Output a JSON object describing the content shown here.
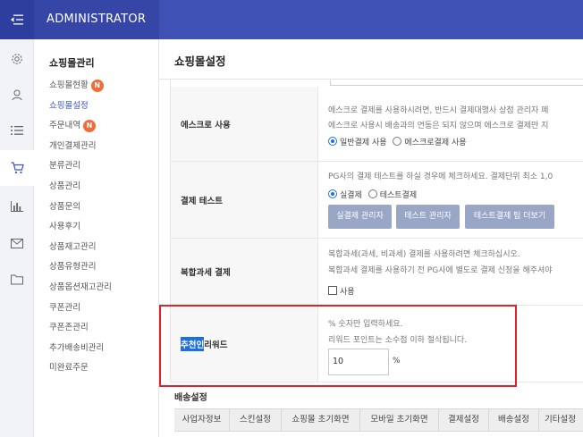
{
  "header": {
    "brand": "ADMINISTRATOR",
    "menu_icon": "menu-collapse-icon"
  },
  "rail": [
    {
      "icon": "gear-icon"
    },
    {
      "icon": "user-icon"
    },
    {
      "icon": "list-icon"
    },
    {
      "icon": "cart-icon",
      "active": true
    },
    {
      "icon": "bar-chart-icon"
    },
    {
      "icon": "mail-icon"
    },
    {
      "icon": "folder-icon"
    }
  ],
  "sidebar": {
    "title": "쇼핑몰관리",
    "items": [
      {
        "label": "쇼핑몰현황",
        "badge": "N"
      },
      {
        "label": "쇼핑몰설정",
        "active": true
      },
      {
        "label": "주문내역",
        "badge": "N"
      },
      {
        "label": "개인결제관리"
      },
      {
        "label": "분류관리"
      },
      {
        "label": "상품관리"
      },
      {
        "label": "상품문의"
      },
      {
        "label": "사용후기"
      },
      {
        "label": "상품재고관리"
      },
      {
        "label": "상품유형관리"
      },
      {
        "label": "상품옵션재고관리"
      },
      {
        "label": "쿠폰관리"
      },
      {
        "label": "쿠폰존관리"
      },
      {
        "label": "추가배송비관리"
      },
      {
        "label": "미완료주문"
      }
    ]
  },
  "main": {
    "title": "쇼핑몰설정",
    "escrow": {
      "label": "에스크로 사용",
      "desc1": "에스크로 결제를 사용하시려면, 반드시 결제대행사 상점 관리자 페",
      "desc2": "에스크로 사용시 배송과의 연동은 되지 않으며 에스크로 결제만 지",
      "opt_general": "일반결제 사용",
      "opt_escrow": "에스크로결제 사용"
    },
    "test": {
      "label": "결제 테스트",
      "desc": "PG사의 결제 테스트를 하실 경우에 체크하세요. 결제단위 최소 1,0",
      "opt_real": "실결제",
      "opt_test": "테스트결제",
      "btn_real_admin": "실결제 관리자",
      "btn_test_admin": "테스트 관리자",
      "btn_tips": "테스트결제 팁 더보기"
    },
    "complex_tax": {
      "label": "복합과세 결제",
      "desc1": "복합과세(과세, 비과세) 결제를 사용하려면 체크하십시오.",
      "desc2": "복합과세 결제를 사용하기 전 PG사에 별도로 결제 신청을 해주셔야",
      "check_label": "사용"
    },
    "reward": {
      "label_selected": "추천인",
      "label_rest": " 리워드",
      "desc1": "% 숫자만 입력하세요.",
      "desc2": "리워드 포인트는 소수점 이하 절삭됩니다.",
      "value": "10",
      "unit": "%"
    },
    "shipping_title": "배송설정",
    "tabs": [
      "사업자정보",
      "스킨설정",
      "쇼핑몰 초기화면",
      "모바일 초기화면",
      "결제설정",
      "배송설정",
      "기타설정"
    ]
  }
}
